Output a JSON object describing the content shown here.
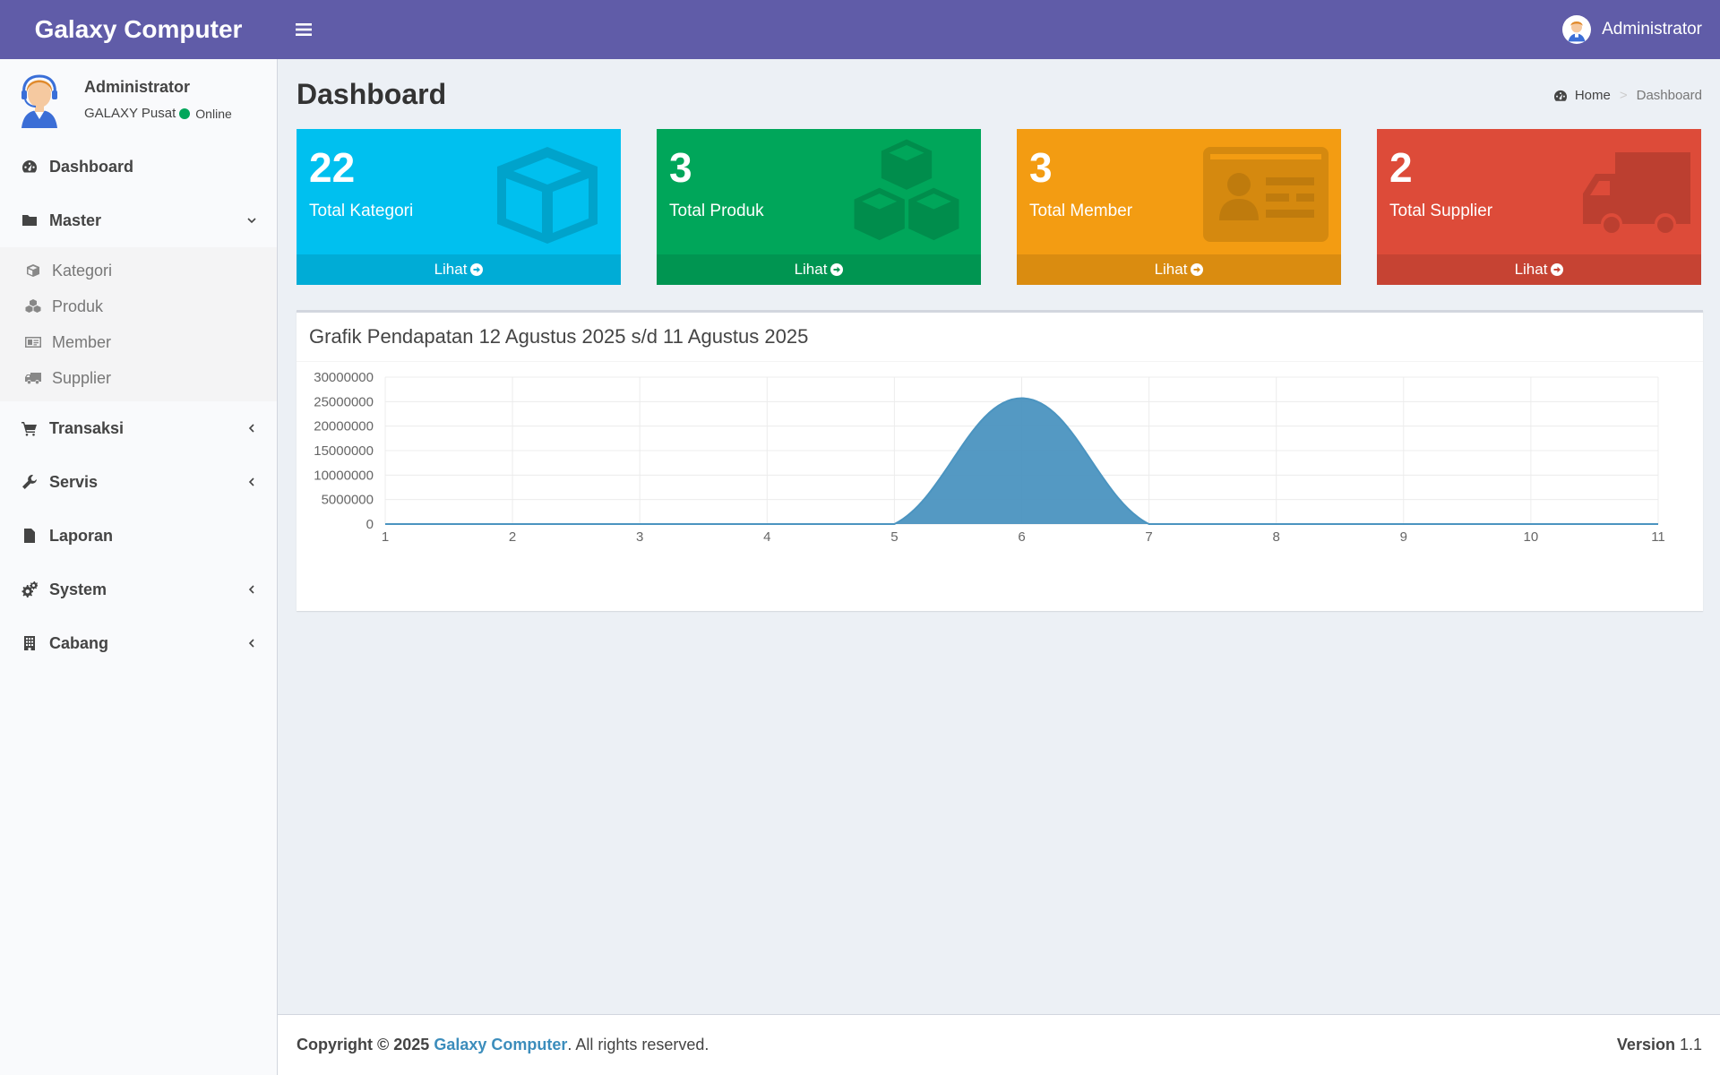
{
  "header": {
    "brand": "Galaxy Computer",
    "user_name": "Administrator"
  },
  "sidebar": {
    "user": {
      "name": "Administrator",
      "branch": "GALAXY Pusat",
      "status": "Online"
    },
    "items": [
      {
        "label": "Dashboard",
        "icon": "dashboard-icon"
      },
      {
        "label": "Master",
        "icon": "folder-icon",
        "expanded": true,
        "children": [
          {
            "label": "Kategori",
            "icon": "cube-icon"
          },
          {
            "label": "Produk",
            "icon": "cubes-icon"
          },
          {
            "label": "Member",
            "icon": "id-card-icon"
          },
          {
            "label": "Supplier",
            "icon": "truck-icon"
          }
        ]
      },
      {
        "label": "Transaksi",
        "icon": "shopping-cart-icon"
      },
      {
        "label": "Servis",
        "icon": "wrench-icon"
      },
      {
        "label": "Laporan",
        "icon": "file-text-icon"
      },
      {
        "label": "System",
        "icon": "cogs-icon"
      },
      {
        "label": "Cabang",
        "icon": "building-icon"
      }
    ]
  },
  "page": {
    "title": "Dashboard",
    "breadcrumb": {
      "home": "Home",
      "current": "Dashboard"
    }
  },
  "stats": [
    {
      "value": "22",
      "label": "Total Kategori",
      "link": "Lihat",
      "color": "#00c0ef",
      "icon": "cube-icon"
    },
    {
      "value": "3",
      "label": "Total Produk",
      "link": "Lihat",
      "color": "#00a65a",
      "icon": "cubes-icon"
    },
    {
      "value": "3",
      "label": "Total Member",
      "link": "Lihat",
      "color": "#f39c12",
      "icon": "id-card-icon"
    },
    {
      "value": "2",
      "label": "Total Supplier",
      "link": "Lihat",
      "color": "#dd4b39",
      "icon": "truck-icon"
    }
  ],
  "chart_title": "Grafik Pendapatan 12 Agustus 2025 s/d 11 Agustus 2025",
  "chart_data": {
    "type": "area",
    "x": [
      1,
      2,
      3,
      4,
      5,
      6,
      7,
      8,
      9,
      10,
      11
    ],
    "series": [
      {
        "values": [
          0,
          0,
          0,
          0,
          0,
          25700000,
          0,
          0,
          0,
          0,
          0
        ],
        "color": "#4b94c0"
      }
    ],
    "ylim": [
      0,
      30000000
    ],
    "yticks": [
      0,
      5000000,
      10000000,
      15000000,
      20000000,
      25000000,
      30000000
    ],
    "grid": true
  },
  "footer": {
    "copyright": "Copyright © 2025",
    "company": "Galaxy Computer",
    "rights": ". All rights reserved.",
    "version_label": "Version",
    "version": "1.1"
  }
}
